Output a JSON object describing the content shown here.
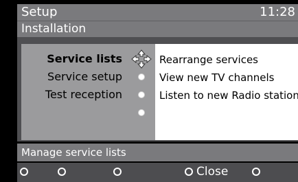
{
  "header": {
    "title": "Setup",
    "clock": "11:28",
    "subtitle": "Installation"
  },
  "menu": {
    "items": [
      {
        "label": "Service lists",
        "selected": true
      },
      {
        "label": "Service setup",
        "selected": false
      },
      {
        "label": "Test reception",
        "selected": false
      }
    ]
  },
  "options": [
    "Rearrange services",
    "View new TV channels",
    "Listen to new Radio stations"
  ],
  "status_text": "Manage service lists",
  "footer": {
    "close_label": "Close"
  },
  "colors": {
    "header_bg": "#7a7a7d",
    "panel_bg": "#4f4f52",
    "menu_bg": "#9b9b9d",
    "options_bg": "#ffffff",
    "footer_bg": "#4d4d50"
  }
}
